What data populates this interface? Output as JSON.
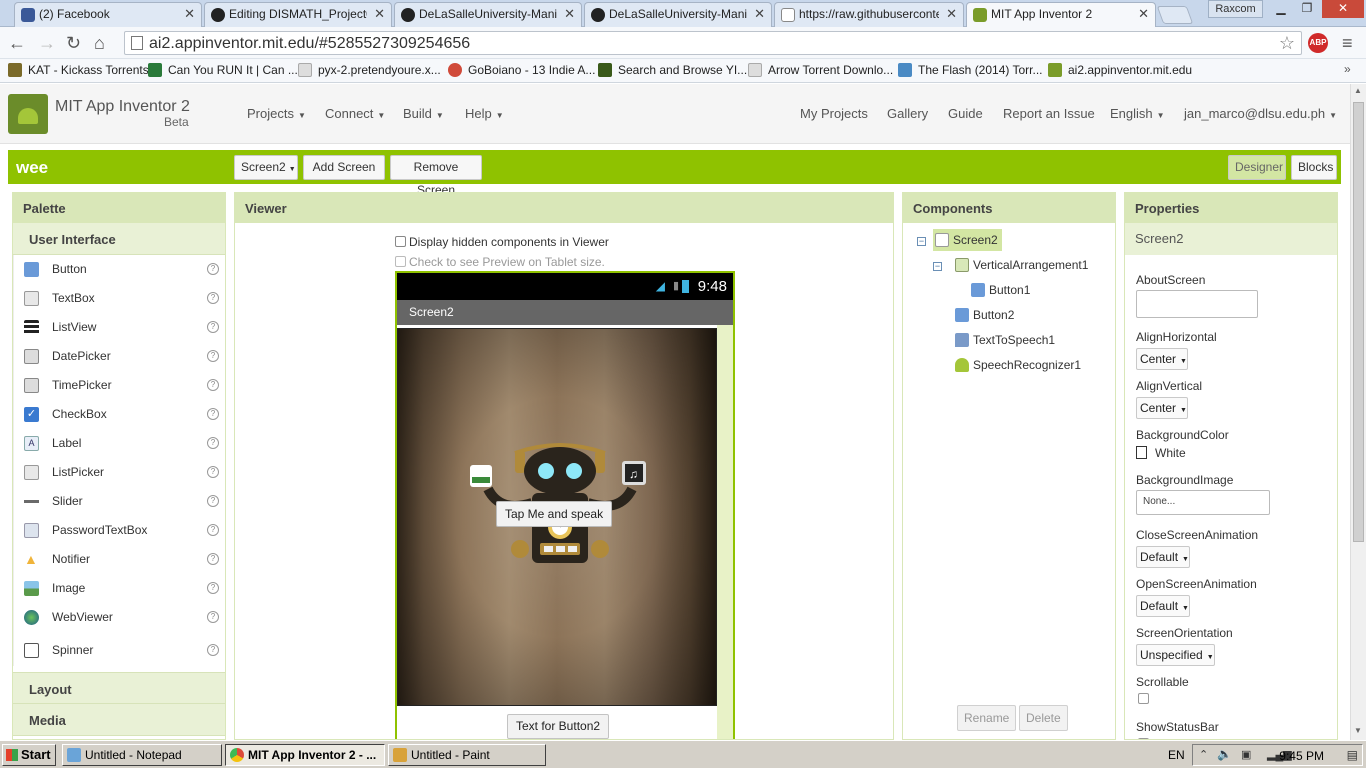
{
  "browser": {
    "tabs": [
      {
        "title": "(2) Facebook",
        "fav_color": "#3b5998"
      },
      {
        "title": "Editing DISMATH_Project0.0",
        "fav_color": "#222222"
      },
      {
        "title": "DeLaSalleUniversity-Manila-D",
        "fav_color": "#222222"
      },
      {
        "title": "DeLaSalleUniversity-Manila-D",
        "fav_color": "#222222"
      },
      {
        "title": "https://raw.githubuserconte",
        "fav_color": "#cccccc"
      },
      {
        "title": "MIT App Inventor 2",
        "fav_color": "#7a9c2a"
      }
    ],
    "profile": "Raxcom",
    "url": "ai2.appinventor.mit.edu/#5285527309254656",
    "adblock_label": "ABP",
    "bookmarks": [
      {
        "label": "KAT - Kickass Torrents",
        "color": "#7a6a2a"
      },
      {
        "label": "Can You RUN It | Can ...",
        "color": "#2a7a3a"
      },
      {
        "label": "pyx-2.pretendyoure.x...",
        "color": "#cccccc"
      },
      {
        "label": "GoBoiano - 13 Indie A...",
        "color": "#d04a3a"
      },
      {
        "label": "Search and Browse YI...",
        "color": "#3a5a1a"
      },
      {
        "label": "Arrow Torrent Downlo...",
        "color": "#cccccc"
      },
      {
        "label": "The Flash (2014) Torr...",
        "color": "#4a8ac4"
      },
      {
        "label": "ai2.appinventor.mit.edu",
        "color": "#7a9c2a"
      }
    ]
  },
  "app": {
    "title": "MIT App Inventor 2",
    "beta": "Beta",
    "menu": [
      "Projects",
      "Connect",
      "Build",
      "Help"
    ],
    "right_menu": {
      "my_projects": "My Projects",
      "gallery": "Gallery",
      "guide": "Guide",
      "report": "Report an Issue",
      "language": "English",
      "user": "jan_marco@dlsu.edu.ph"
    }
  },
  "toolbar": {
    "project": "wee",
    "screen_select": "Screen2",
    "add_screen": "Add Screen ...",
    "remove_screen": "Remove Screen",
    "designer": "Designer",
    "blocks": "Blocks"
  },
  "palette": {
    "header": "Palette",
    "section": "User Interface",
    "items": [
      {
        "label": "Button",
        "icon": "button-icon",
        "color": "#6a9ad8"
      },
      {
        "label": "TextBox",
        "icon": "textbox-icon",
        "color": "#e8e8e8"
      },
      {
        "label": "ListView",
        "icon": "listview-icon",
        "color": "#222222"
      },
      {
        "label": "DatePicker",
        "icon": "datepicker-icon",
        "color": "#dddddd"
      },
      {
        "label": "TimePicker",
        "icon": "timepicker-icon",
        "color": "#dddddd"
      },
      {
        "label": "CheckBox",
        "icon": "checkbox-icon",
        "color": "#3a7ad0"
      },
      {
        "label": "Label",
        "icon": "label-icon",
        "color": "#e8eef8"
      },
      {
        "label": "ListPicker",
        "icon": "listpicker-icon",
        "color": "#e8e8e8"
      },
      {
        "label": "Slider",
        "icon": "slider-icon",
        "color": "#6a6a6a"
      },
      {
        "label": "PasswordTextBox",
        "icon": "password-icon",
        "color": "#dde4ee"
      },
      {
        "label": "Notifier",
        "icon": "notifier-icon",
        "color": "#f0b43a"
      },
      {
        "label": "Image",
        "icon": "image-icon",
        "color": "#5a9a4a"
      },
      {
        "label": "WebViewer",
        "icon": "webviewer-icon",
        "color": "#2a7a3a"
      },
      {
        "label": "Spinner",
        "icon": "spinner-icon",
        "color": "#555555"
      }
    ],
    "help": "?",
    "layout": "Layout",
    "media": "Media"
  },
  "viewer": {
    "header": "Viewer",
    "hidden_components": "Display hidden components in Viewer",
    "tablet_preview": "Check to see Preview on Tablet size.",
    "phone_time": "9:48",
    "screen_title": "Screen2",
    "button1_text": "Tap Me and speak",
    "button2_text": "Text for Button2"
  },
  "components": {
    "header": "Components",
    "tree": {
      "screen": "Screen2",
      "vertical": "VerticalArrangement1",
      "button1": "Button1",
      "button2": "Button2",
      "tts": "TextToSpeech1",
      "speech": "SpeechRecognizer1"
    },
    "rename": "Rename",
    "delete": "Delete"
  },
  "properties": {
    "header": "Properties",
    "component": "Screen2",
    "about_screen": "AboutScreen",
    "align_h": "AlignHorizontal",
    "align_h_value": "Center",
    "align_v": "AlignVertical",
    "align_v_value": "Center",
    "bg_color": "BackgroundColor",
    "bg_color_value": "White",
    "bg_image": "BackgroundImage",
    "bg_image_value": "None...",
    "close_anim": "CloseScreenAnimation",
    "close_anim_value": "Default",
    "open_anim": "OpenScreenAnimation",
    "open_anim_value": "Default",
    "orientation": "ScreenOrientation",
    "orientation_value": "Unspecified",
    "scrollable": "Scrollable",
    "status_bar": "ShowStatusBar"
  },
  "taskbar": {
    "start": "Start",
    "items": [
      {
        "label": "Untitled - Notepad",
        "color": "#6aa4d8"
      },
      {
        "label": "MIT App Inventor 2 - ...",
        "color": "#dd4b39"
      },
      {
        "label": "Untitled - Paint",
        "color": "#d8a23a"
      }
    ],
    "lang": "EN",
    "time": "9:45 PM"
  }
}
